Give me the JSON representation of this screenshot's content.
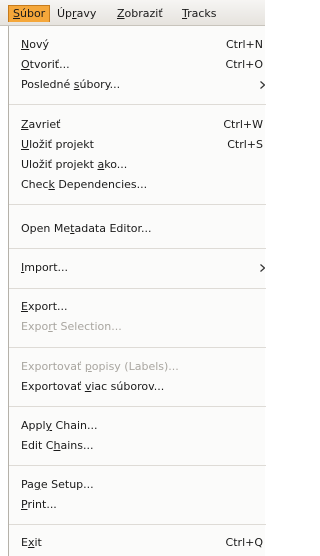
{
  "menubar": {
    "items": [
      {
        "pre": "",
        "mn": "S",
        "post": "úbor"
      },
      {
        "pre": "Úp",
        "mn": "r",
        "post": "avy"
      },
      {
        "pre": "",
        "mn": "Z",
        "post": "obraziť"
      },
      {
        "pre": "",
        "mn": "T",
        "post": "racks"
      }
    ]
  },
  "menu": {
    "items": [
      {
        "pre": "",
        "mn": "N",
        "post": "ový",
        "accel": "Ctrl+N",
        "disabled": false
      },
      {
        "pre": "",
        "mn": "O",
        "post": "tvoriť...",
        "accel": "Ctrl+O",
        "disabled": false
      },
      {
        "pre": "Posledné ",
        "mn": "s",
        "post": "úbory...",
        "accel": "",
        "disabled": false
      },
      {
        "pre": "",
        "mn": "Z",
        "post": "avrieť",
        "accel": "Ctrl+W",
        "disabled": false
      },
      {
        "pre": "",
        "mn": "U",
        "post": "ložiť projekt",
        "accel": "Ctrl+S",
        "disabled": false
      },
      {
        "pre": "Uložiť projekt ",
        "mn": "a",
        "post": "ko...",
        "accel": "",
        "disabled": false
      },
      {
        "pre": "Chec",
        "mn": "k",
        "post": " Dependencies...",
        "accel": "",
        "disabled": false
      },
      {
        "pre": "Open Me",
        "mn": "t",
        "post": "adata Editor...",
        "accel": "",
        "disabled": false
      },
      {
        "pre": "",
        "mn": "I",
        "post": "mport...",
        "accel": "",
        "disabled": false
      },
      {
        "pre": "",
        "mn": "E",
        "post": "xport...",
        "accel": "",
        "disabled": false
      },
      {
        "pre": "Expo",
        "mn": "r",
        "post": "t Selection...",
        "accel": "",
        "disabled": true
      },
      {
        "pre": "Exportovať ",
        "mn": "p",
        "post": "opisy (Labels)...",
        "accel": "",
        "disabled": true
      },
      {
        "pre": "Exportovať ",
        "mn": "v",
        "post": "iac súborov...",
        "accel": "",
        "disabled": false
      },
      {
        "pre": "Appl",
        "mn": "y",
        "post": " Chain...",
        "accel": "",
        "disabled": false
      },
      {
        "pre": "Edit C",
        "mn": "h",
        "post": "ains...",
        "accel": "",
        "disabled": false
      },
      {
        "pre": "Pa",
        "mn": "g",
        "post": "e Setup...",
        "accel": "",
        "disabled": false
      },
      {
        "pre": "",
        "mn": "P",
        "post": "rint...",
        "accel": "",
        "disabled": false
      },
      {
        "pre": "E",
        "mn": "x",
        "post": "it",
        "accel": "Ctrl+Q",
        "disabled": false
      }
    ]
  }
}
